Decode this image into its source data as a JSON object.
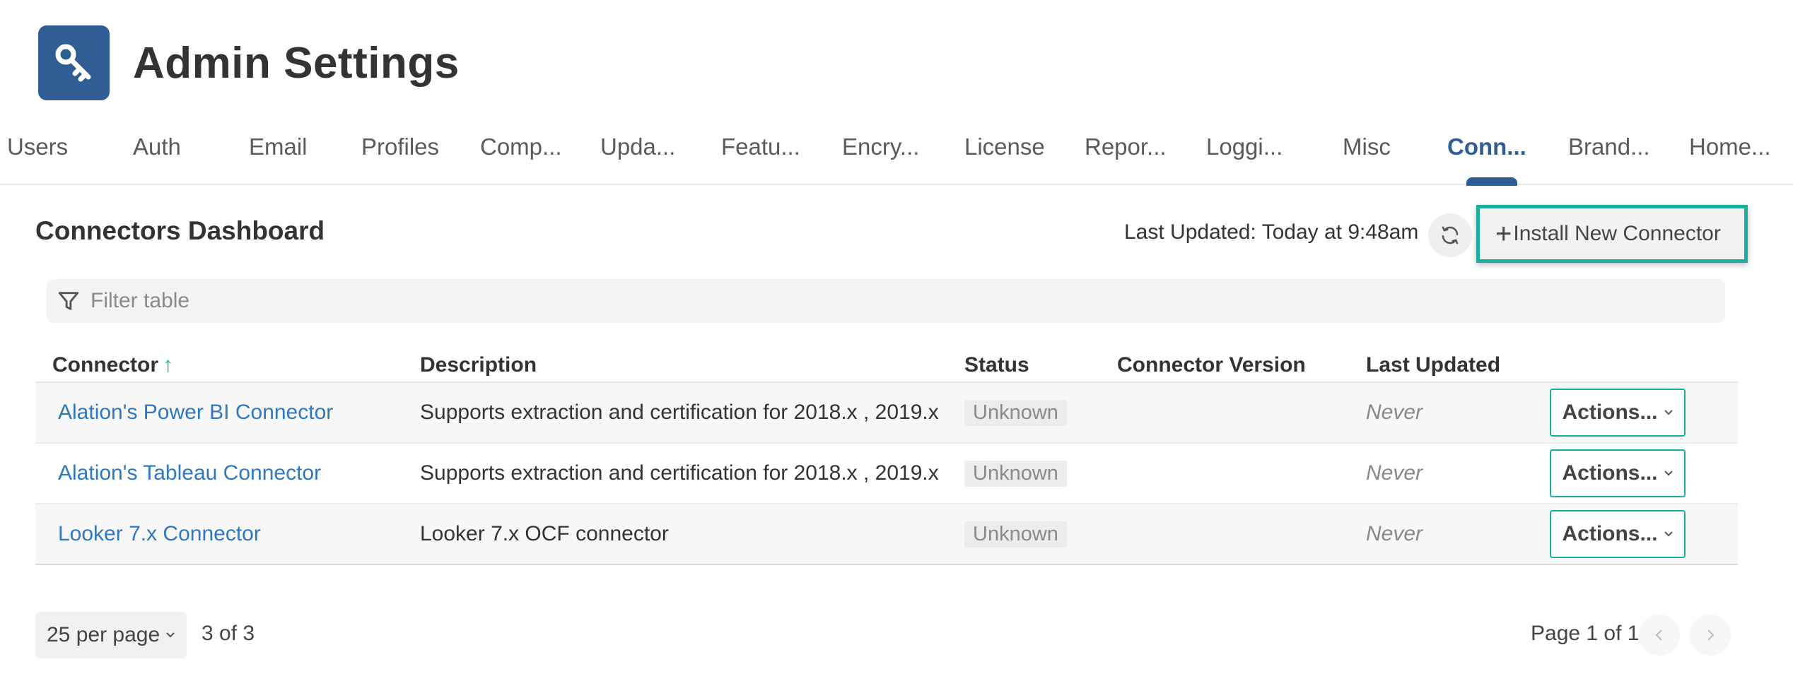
{
  "header": {
    "title": "Admin Settings",
    "icon": "key-icon",
    "icon_color": "#2f5d94"
  },
  "tabs": [
    {
      "label": "Users"
    },
    {
      "label": "Auth"
    },
    {
      "label": "Email"
    },
    {
      "label": "Profiles"
    },
    {
      "label": "Comp..."
    },
    {
      "label": "Upda..."
    },
    {
      "label": "Featu..."
    },
    {
      "label": "Encry..."
    },
    {
      "label": "License"
    },
    {
      "label": "Repor..."
    },
    {
      "label": "Loggi..."
    },
    {
      "label": "Misc"
    },
    {
      "label": "Conn...",
      "active": true
    },
    {
      "label": "Brand..."
    },
    {
      "label": "Home..."
    }
  ],
  "dashboard": {
    "title": "Connectors Dashboard",
    "last_updated": "Last Updated: Today at 9:48am",
    "refresh_icon": "refresh-icon",
    "install_label": "Install New Connector",
    "install_icon": "plus-icon",
    "accent_color": "#1bae9a"
  },
  "filter": {
    "placeholder": "Filter table",
    "value": "",
    "icon": "filter-icon"
  },
  "table": {
    "columns": [
      "Connector",
      "Description",
      "Status",
      "Connector Version",
      "Last Updated"
    ],
    "sort_icon": "sort-ascending-icon",
    "rows": [
      {
        "connector": "Alation's Power BI Connector",
        "description": "Supports extraction and certification for 2018.x , 2019.x",
        "status": "Unknown",
        "version": "",
        "last_updated": "Never",
        "action_label": "Actions..."
      },
      {
        "connector": "Alation's Tableau Connector",
        "description": "Supports extraction and certification for 2018.x , 2019.x",
        "status": "Unknown",
        "version": "",
        "last_updated": "Never",
        "action_label": "Actions..."
      },
      {
        "connector": "Looker 7.x Connector",
        "description": "Looker 7.x OCF connector",
        "status": "Unknown",
        "version": "",
        "last_updated": "Never",
        "action_label": "Actions..."
      }
    ]
  },
  "footer": {
    "per_page": "25 per page",
    "count": "3 of 3",
    "page_info": "Page 1 of 1",
    "prev_icon": "chevron-left-icon",
    "next_icon": "chevron-right-icon"
  }
}
